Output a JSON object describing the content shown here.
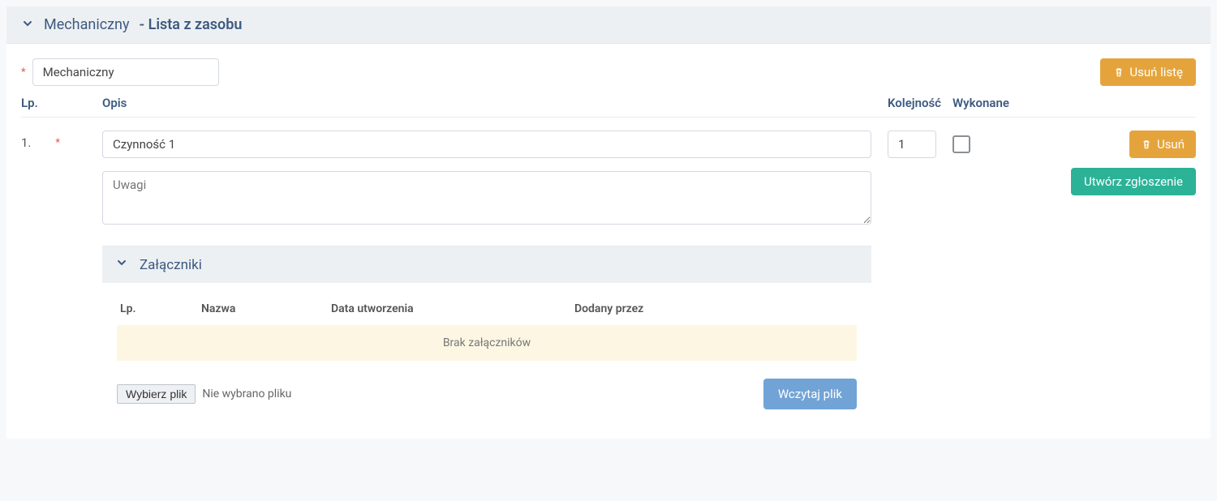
{
  "header": {
    "title_main": "Mechaniczny",
    "title_suffix": "- Lista z zasobu"
  },
  "form": {
    "name_value": "Mechaniczny",
    "delete_list_label": "Usuń listę"
  },
  "columns": {
    "lp": "Lp.",
    "opis": "Opis",
    "kolejnosc": "Kolejność",
    "wykonane": "Wykonane"
  },
  "row": {
    "lp": "1.",
    "opis_value": "Czynność 1",
    "uwagi_placeholder": "Uwagi",
    "kolejnosc_value": "1",
    "delete_label": "Usuń",
    "create_report_label": "Utwórz zgłoszenie"
  },
  "attachments": {
    "title": "Załączniki",
    "cols": {
      "lp": "Lp.",
      "nazwa": "Nazwa",
      "data": "Data utworzenia",
      "dodany": "Dodany przez"
    },
    "empty_msg": "Brak załączników",
    "choose_file_label": "Wybierz plik",
    "no_file_label": "Nie wybrano pliku",
    "upload_label": "Wczytaj plik"
  }
}
